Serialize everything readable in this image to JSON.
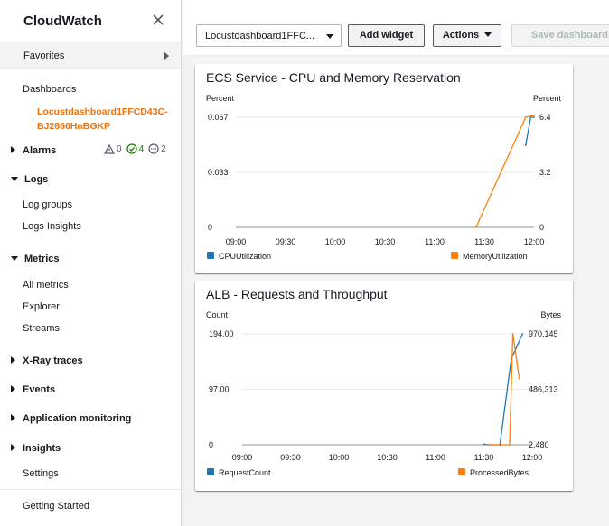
{
  "sidebar": {
    "title": "CloudWatch",
    "favorites_label": "Favorites",
    "dashboards_label": "Dashboards",
    "active_dashboard": "Locustdashboard1FFCD43C-BJ2866HnBGKP",
    "alarms": {
      "label": "Alarms",
      "in_alarm": "0",
      "ok": "4",
      "insufficient": "2"
    },
    "logs": {
      "label": "Logs",
      "items": [
        "Log groups",
        "Logs Insights"
      ]
    },
    "metrics": {
      "label": "Metrics",
      "items": [
        "All metrics",
        "Explorer",
        "Streams"
      ]
    },
    "xray_label": "X-Ray traces",
    "events_label": "Events",
    "app_monitoring_label": "Application monitoring",
    "insights_label": "Insights",
    "settings_label": "Settings",
    "getting_started_label": "Getting Started"
  },
  "toolbar": {
    "dashboard_select": "Locustdashboard1FFC...",
    "add_widget": "Add widget",
    "actions": "Actions",
    "save_dashboard": "Save dashboard"
  },
  "colors": {
    "blue": "#1f77b4",
    "orange": "#ff7f0e",
    "accent": "#ec7211"
  },
  "widgets": [
    {
      "title": "ECS Service - CPU and Memory Reservation",
      "left_unit": "Percent",
      "right_unit": "Percent",
      "chart_data": {
        "type": "line",
        "x_ticks": [
          "09:00",
          "09:30",
          "10:00",
          "10:30",
          "11:00",
          "11:30",
          "12:00"
        ],
        "y_left_ticks": [
          "0",
          "0.033",
          "0.067"
        ],
        "y_right_ticks": [
          "0",
          "3.2",
          "6.4"
        ],
        "ylim_left": [
          0,
          0.067
        ],
        "ylim_right": [
          0,
          6.4
        ],
        "xlim": [
          "09:00",
          "12:00"
        ],
        "series": [
          {
            "name": "CPUUtilization",
            "axis": "left",
            "color": "#1f77b4",
            "points": [
              [
                "11:55",
                0.05
              ],
              [
                "11:58",
                0.067
              ],
              [
                "12:00",
                0.067
              ]
            ]
          },
          {
            "name": "MemoryUtilization",
            "axis": "right",
            "color": "#ff7f0e",
            "points": [
              [
                "11:25",
                0.0
              ],
              [
                "11:55",
                6.4
              ],
              [
                "12:00",
                6.5
              ]
            ]
          }
        ]
      }
    },
    {
      "title": "ALB - Requests and Throughput",
      "left_unit": "Count",
      "right_unit": "Bytes",
      "chart_data": {
        "type": "line",
        "x_ticks": [
          "09:00",
          "09:30",
          "10:00",
          "10:30",
          "11:00",
          "11:30",
          "12:00"
        ],
        "y_left_ticks": [
          "0",
          "97.00",
          "194.00"
        ],
        "y_right_ticks": [
          "2,480",
          "486,313",
          "970,145"
        ],
        "ylim_left": [
          0,
          194
        ],
        "ylim_right": [
          2480,
          970145
        ],
        "xlim": [
          "09:00",
          "12:00"
        ],
        "series": [
          {
            "name": "RequestCount",
            "axis": "left",
            "color": "#1f77b4",
            "points": [
              [
                "11:30",
                1
              ],
              [
                "11:33",
                0
              ],
              [
                "11:40",
                0
              ],
              [
                "11:47",
                150
              ],
              [
                "11:54",
                194
              ]
            ]
          },
          {
            "name": "ProcessedBytes",
            "axis": "right",
            "color": "#ff7f0e",
            "points": [
              [
                "11:32",
                2480
              ],
              [
                "11:46",
                2480
              ],
              [
                "11:48",
                970145
              ],
              [
                "11:52",
                580000
              ]
            ]
          }
        ]
      }
    }
  ]
}
